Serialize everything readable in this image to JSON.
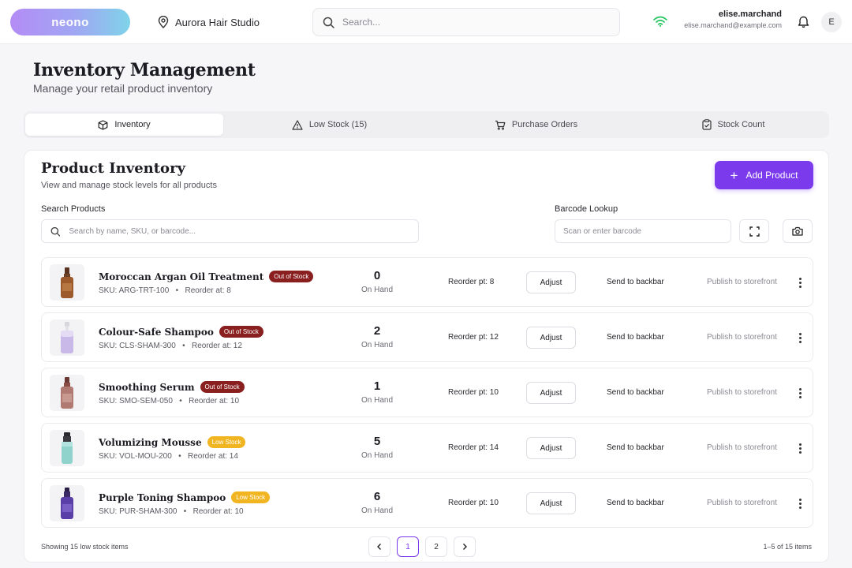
{
  "app": {
    "logo_text": "neono",
    "location": "Aurora Hair Studio",
    "search_placeholder": "Search...",
    "user_name": "elise.marchand",
    "user_email": "elise.marchand@example.com",
    "avatar_initial": "E"
  },
  "page": {
    "title": "Inventory Management",
    "subtitle": "Manage your retail product inventory"
  },
  "tabs": [
    {
      "label": "Inventory",
      "icon": "box-icon",
      "active": true
    },
    {
      "label": "Low Stock (15)",
      "icon": "warning-icon",
      "active": false
    },
    {
      "label": "Purchase Orders",
      "icon": "cart-icon",
      "active": false
    },
    {
      "label": "Stock Count",
      "icon": "clipboard-icon",
      "active": false
    }
  ],
  "inventory": {
    "title": "Product Inventory",
    "subtitle": "View and manage stock levels for all products",
    "add_label": "Add Product",
    "search_label": "Search Products",
    "search_placeholder": "Search by name, SKU, or barcode...",
    "barcode_label": "Barcode Lookup",
    "barcode_placeholder": "Scan or enter barcode",
    "on_hand_label": "On Hand",
    "adjust_label": "Adjust",
    "backbar_label": "Send to backbar",
    "publish_label": "Publish to storefront",
    "rows": [
      {
        "name": "Moroccan Argan Oil Treatment",
        "badge": "Out of Stock",
        "badge_type": "out",
        "sku": "SKU: ARG-TRT-100",
        "reorder_at": "Reorder at: 8",
        "qty": "0",
        "reorder_pt": "Reorder pt: 8"
      },
      {
        "name": "Colour-Safe Shampoo",
        "badge": "Out of Stock",
        "badge_type": "out",
        "sku": "SKU: CLS-SHAM-300",
        "reorder_at": "Reorder at: 12",
        "qty": "2",
        "reorder_pt": "Reorder pt: 12"
      },
      {
        "name": "Smoothing Serum",
        "badge": "Out of Stock",
        "badge_type": "out",
        "sku": "SKU: SMO-SEM-050",
        "reorder_at": "Reorder at: 10",
        "qty": "1",
        "reorder_pt": "Reorder pt: 10"
      },
      {
        "name": "Volumizing Mousse",
        "badge": "Low Stock",
        "badge_type": "low",
        "sku": "SKU: VOL-MOU-200",
        "reorder_at": "Reorder at: 14",
        "qty": "5",
        "reorder_pt": "Reorder pt: 14"
      },
      {
        "name": "Purple Toning Shampoo",
        "badge": "Low Stock",
        "badge_type": "low",
        "sku": "SKU: PUR-SHAM-300",
        "reorder_at": "Reorder at: 10",
        "qty": "6",
        "reorder_pt": "Reorder pt: 10"
      }
    ],
    "footer_showing": "Showing 15 low stock items",
    "pages": [
      "1",
      "2"
    ],
    "current_page": "1",
    "range": "1–5 of 15 items"
  },
  "colors": {
    "accent": "#7c3aed",
    "out_of_stock": "#8a1f1f",
    "low_stock": "#f2b522",
    "wifi": "#22c55e"
  }
}
